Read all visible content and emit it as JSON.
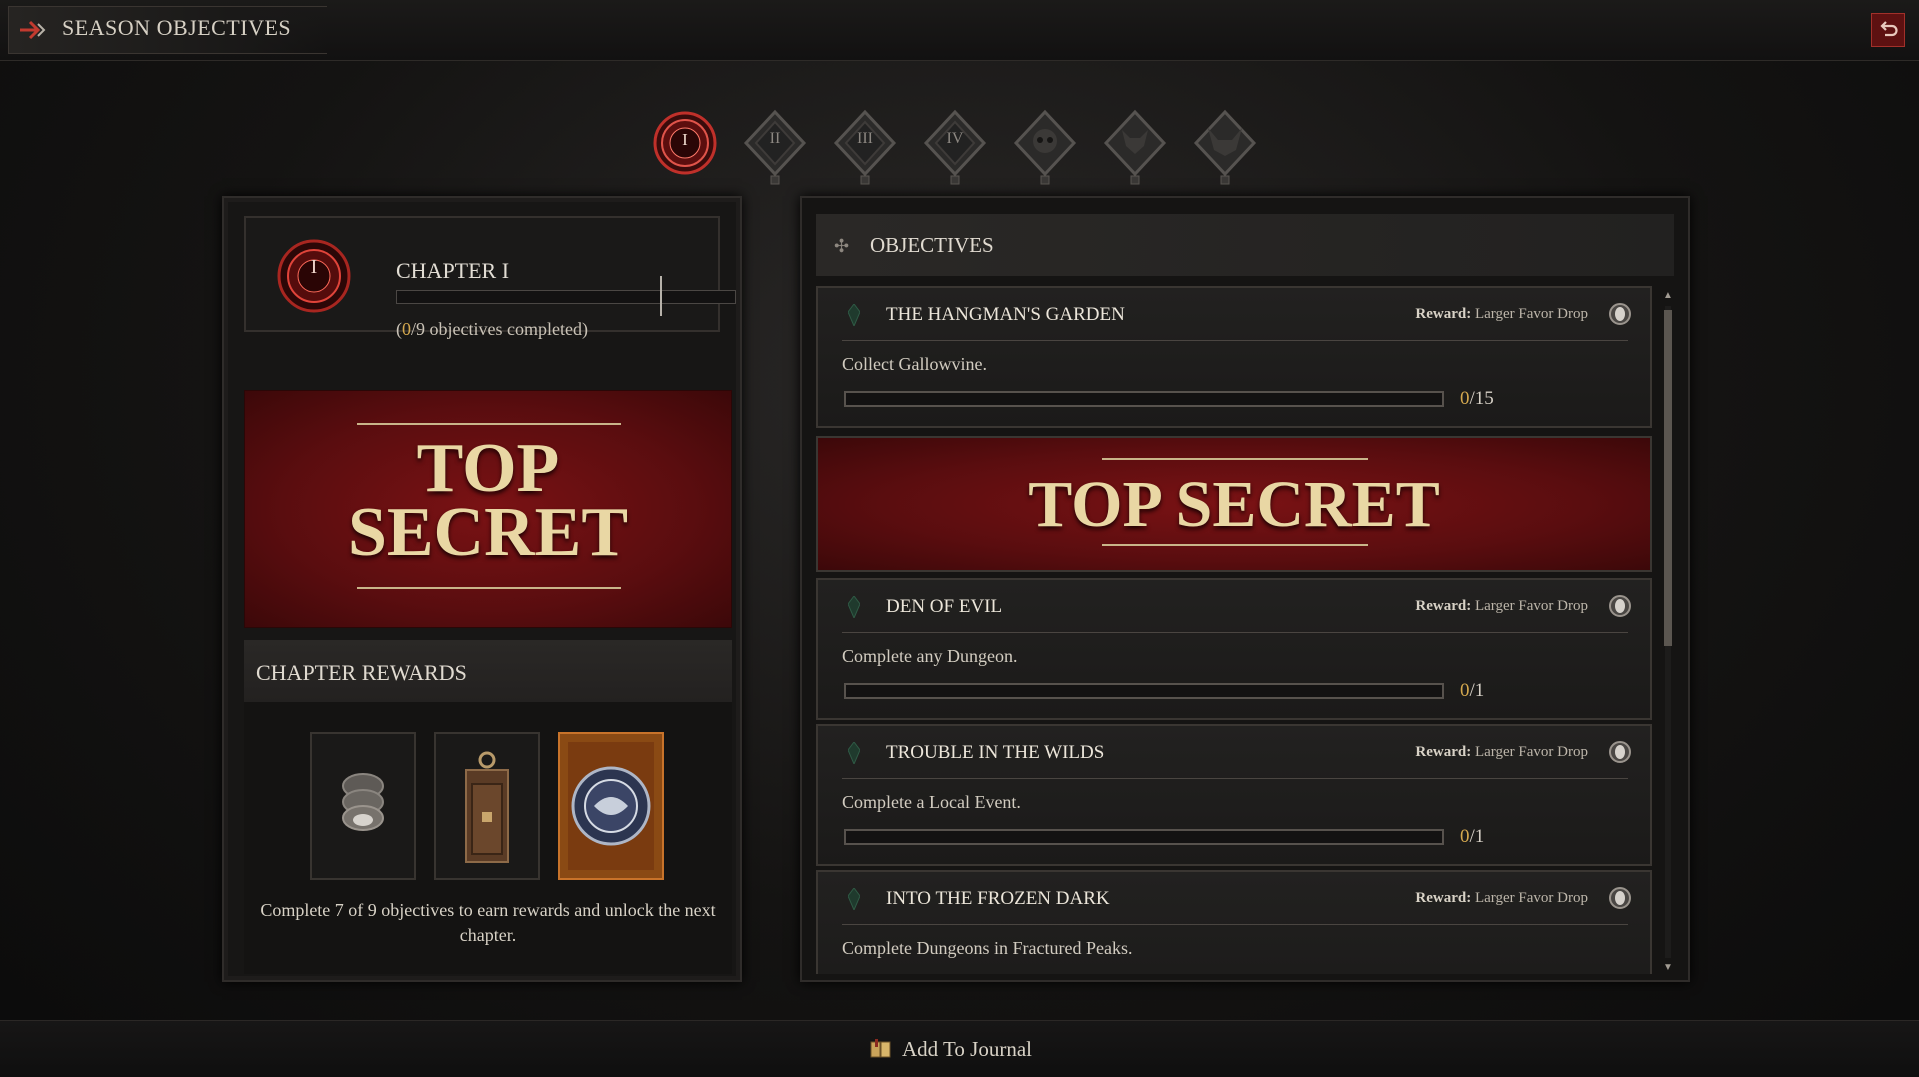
{
  "header": {
    "title": "SEASON OBJECTIVES"
  },
  "chapter_tabs": [
    {
      "label": "I",
      "active": true
    },
    {
      "label": "II",
      "active": false
    },
    {
      "label": "III",
      "active": false
    },
    {
      "label": "IV",
      "active": false
    },
    {
      "label": "",
      "active": false
    },
    {
      "label": "",
      "active": false
    },
    {
      "label": "",
      "active": false
    }
  ],
  "chapter": {
    "numeral": "I",
    "title": "CHAPTER I",
    "completed": "0",
    "progress_rest": "/9 objectives completed)",
    "progress_open": "(",
    "secret_line1": "TOP",
    "secret_line2": "SECRET"
  },
  "rewards": {
    "title": "CHAPTER REWARDS",
    "description": "Complete 7 of 9 objectives to earn rewards and unlock the next chapter.",
    "items": [
      "coin-stack-icon",
      "chest-icon",
      "emblem-icon"
    ]
  },
  "objectives": {
    "title": "OBJECTIVES",
    "reward_prefix": "Reward:",
    "items": [
      {
        "title": "THE HANGMAN'S GARDEN",
        "reward": "Larger Favor Drop",
        "desc": "Collect Gallowvine.",
        "count": "0",
        "total": "/15",
        "progress": 0
      },
      {
        "title": "DEN OF EVIL",
        "reward": "Larger Favor Drop",
        "desc": "Complete any Dungeon.",
        "count": "0",
        "total": "/1",
        "progress": 0
      },
      {
        "title": "TROUBLE IN THE WILDS",
        "reward": "Larger Favor Drop",
        "desc": "Complete a Local Event.",
        "count": "0",
        "total": "/1",
        "progress": 0
      },
      {
        "title": "INTO THE FROZEN DARK",
        "reward": "Larger Favor Drop",
        "desc": "Complete Dungeons in Fractured Peaks.",
        "count": "",
        "total": "",
        "progress": 0
      }
    ],
    "secret_text": "TOP SECRET"
  },
  "footer": {
    "journal_label": "Add To Journal"
  },
  "colors": {
    "accent_red": "#7a1214",
    "gold": "#d4a84e",
    "secret_text": "#e9d7a4"
  }
}
